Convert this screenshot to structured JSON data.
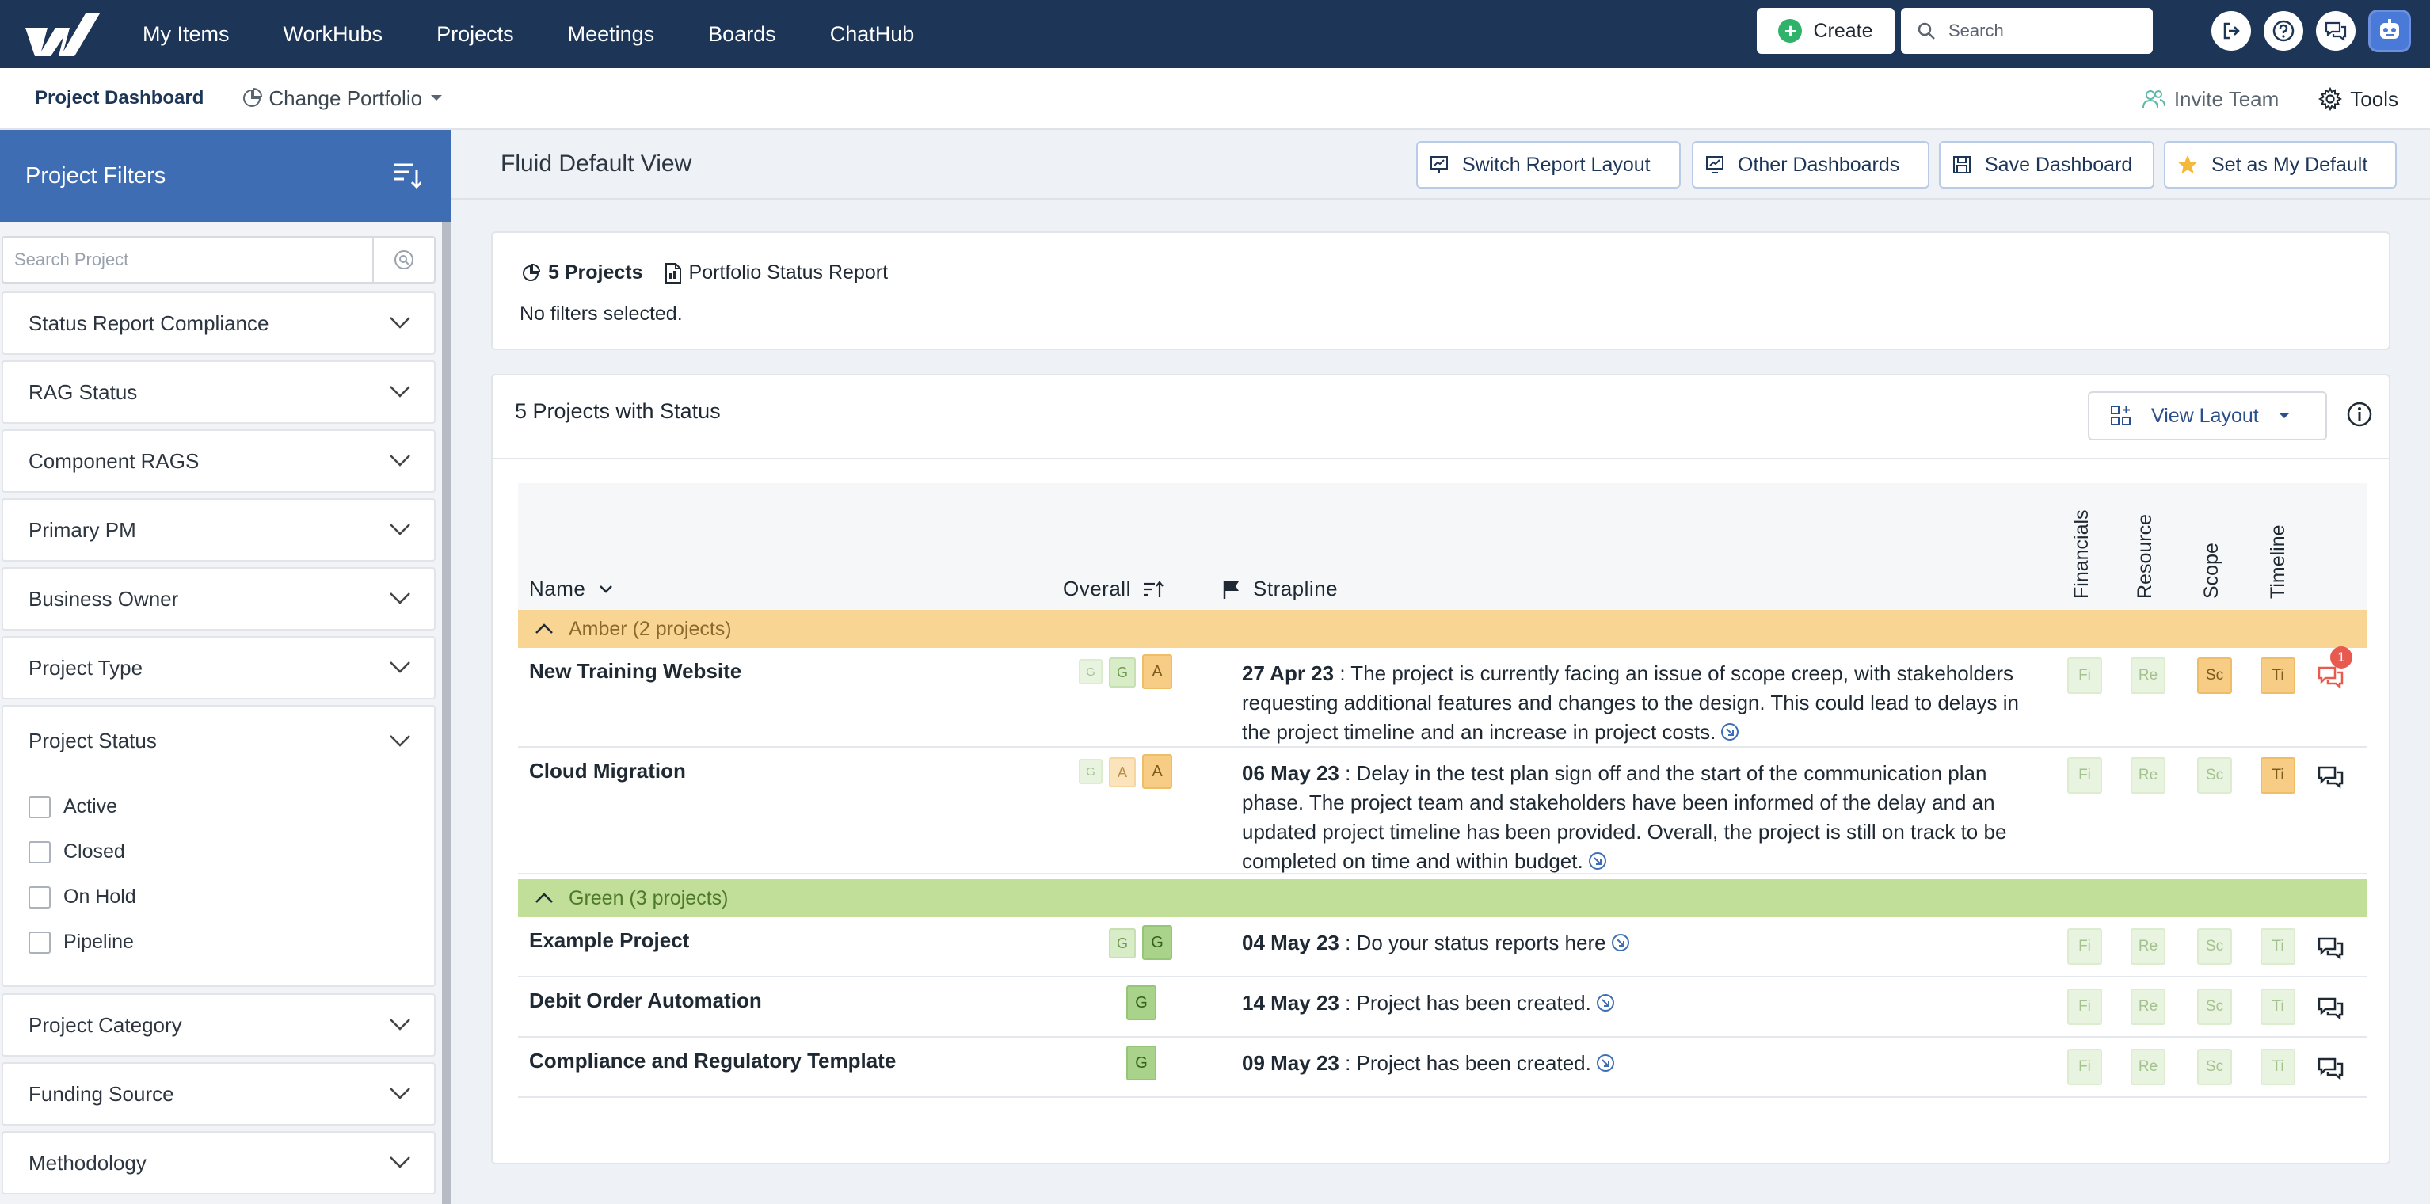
{
  "topnav": {
    "items": [
      "My Items",
      "WorkHubs",
      "Projects",
      "Meetings",
      "Boards",
      "ChatHub"
    ],
    "create_label": "Create",
    "search_placeholder": "Search"
  },
  "subnav": {
    "active_tab": "Project Dashboard",
    "portfolio_label": "Change Portfolio",
    "invite_label": "Invite Team",
    "tools_label": "Tools"
  },
  "sidebar": {
    "title": "Project Filters",
    "search_placeholder": "Search Project",
    "filters": [
      "Status Report Compliance",
      "RAG Status",
      "Component RAGS",
      "Primary PM",
      "Business Owner",
      "Project Type"
    ],
    "status_filter": {
      "title": "Project Status",
      "options": [
        "Active",
        "Closed",
        "On Hold",
        "Pipeline"
      ]
    },
    "more_filters": [
      "Project Category",
      "Funding Source",
      "Methodology"
    ]
  },
  "main": {
    "view_title": "Fluid Default View",
    "buttons": {
      "switch_layout": "Switch Report Layout",
      "other_dashboards": "Other Dashboards",
      "save_dashboard": "Save Dashboard",
      "set_default": "Set as My Default"
    },
    "summary": {
      "count_label": "5 Projects",
      "report_label": "Portfolio Status Report",
      "filters_text": "No filters selected."
    },
    "table": {
      "title": "5 Projects with Status",
      "view_layout_label": "View Layout",
      "columns": {
        "name": "Name",
        "overall": "Overall",
        "strapline": "Strapline",
        "financials": "Financials",
        "resource": "Resource",
        "scope": "Scope",
        "timeline": "Timeline"
      },
      "groups": [
        {
          "label": "Amber (2 projects)",
          "rows": [
            {
              "name": "New Training Website",
              "rag": [
                "G",
                "G",
                "A"
              ],
              "date": "27 Apr 23",
              "text": " : The project is currently facing an issue of scope creep, with stakeholders requesting additional features and changes to the design. This could lead to delays in the project timeline and an increase in project costs.",
              "components": [
                "Fi",
                "Re",
                "Sc",
                "Ti"
              ],
              "comment_count": "1"
            },
            {
              "name": "Cloud Migration",
              "rag": [
                "G",
                "A",
                "A"
              ],
              "date": "06 May 23",
              "text": " : Delay in the test plan sign off and the start of the communication plan phase. The project team and stakeholders have been informed of the delay and an updated project timeline has been provided. Overall, the project is still on track to be completed on time and within budget.",
              "components": [
                "Fi",
                "Re",
                "Sc",
                "Ti"
              ]
            }
          ]
        },
        {
          "label": "Green (3 projects)",
          "rows": [
            {
              "name": "Example Project",
              "rag": [
                "G",
                "G"
              ],
              "date": "04 May 23",
              "text": " : Do your status reports here",
              "components": [
                "Fi",
                "Re",
                "Sc",
                "Ti"
              ]
            },
            {
              "name": "Debit Order Automation",
              "rag": [
                "G"
              ],
              "date": "14 May 23",
              "text": " : Project has been created.",
              "components": [
                "Fi",
                "Re",
                "Sc",
                "Ti"
              ]
            },
            {
              "name": "Compliance and Regulatory Template",
              "rag": [
                "G"
              ],
              "date": "09 May 23",
              "text": " : Project has been created.",
              "components": [
                "Fi",
                "Re",
                "Sc",
                "Ti"
              ]
            }
          ]
        }
      ]
    }
  },
  "colors": {
    "nav_bg": "#1d3557",
    "sidebar_header": "#3e6db3",
    "amber_group": "#f9d594",
    "green_group": "#c2df99",
    "rag_green": "#a9d38a",
    "rag_amber": "#f7cd86"
  }
}
